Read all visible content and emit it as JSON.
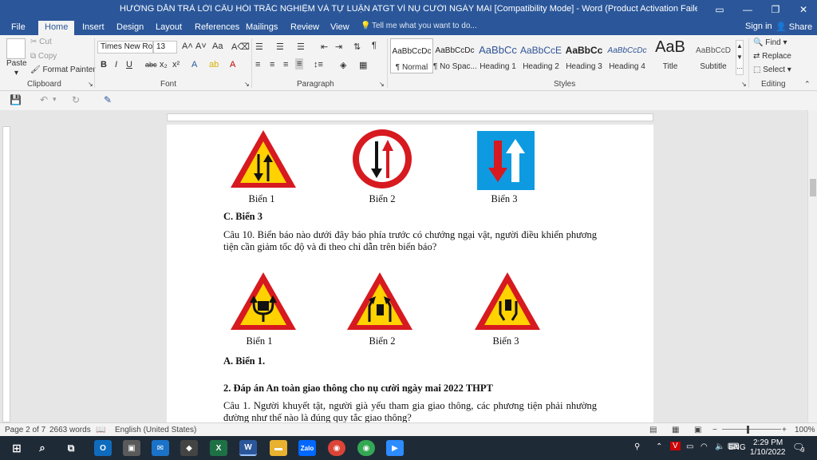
{
  "window": {
    "title": "HƯỚNG DẪN TRẢ LỜI CÂU HỎI TRẮC NGHIỆM VÀ TỰ LUẬN ATGT VÌ NỤ CƯỜI NGÀY MAI [Compatibility Mode] - Word (Product Activation Failed)"
  },
  "tabs": [
    "File",
    "Home",
    "Insert",
    "Design",
    "Layout",
    "References",
    "Mailings",
    "Review",
    "View"
  ],
  "tell_me": "Tell me what you want to do...",
  "sign_in": "Sign in",
  "share": "Share",
  "clipboard": {
    "paste": "Paste",
    "cut": "Cut",
    "copy": "Copy",
    "format_painter": "Format Painter",
    "label": "Clipboard"
  },
  "font": {
    "name": "Times New Ro",
    "size": "13",
    "label": "Font"
  },
  "paragraph": {
    "label": "Paragraph"
  },
  "styles": {
    "label": "Styles",
    "items": [
      {
        "preview": "AaBbCcDc",
        "name": "¶ Normal"
      },
      {
        "preview": "AaBbCcDc",
        "name": "¶ No Spac..."
      },
      {
        "preview": "AaBbCc",
        "name": "Heading 1"
      },
      {
        "preview": "AaBbCcE",
        "name": "Heading 2"
      },
      {
        "preview": "AaBbCc",
        "name": "Heading 3"
      },
      {
        "preview": "AaBbCcDc",
        "name": "Heading 4"
      },
      {
        "preview": "AaB",
        "name": "Title"
      },
      {
        "preview": "AaBbCcD",
        "name": "Subtitle"
      }
    ]
  },
  "editing": {
    "find": "Find",
    "replace": "Replace",
    "select": "Select",
    "label": "Editing"
  },
  "document": {
    "row1_captions": [
      "Biển 1",
      "Biển 2",
      "Biển 3"
    ],
    "answer_c": "C. Biển 3",
    "question10": "Câu 10. Biển báo nào dưới đây báo phía trước có chướng ngại vật, người điều khiển phương tiện cần giảm tốc độ và đi theo chỉ dẫn trên biển báo?",
    "row2_captions": [
      "Biển 1",
      "Biển 2",
      "Biển 3"
    ],
    "answer_a": "A. Biển 1.",
    "heading2": "2. Đáp án An toàn giao thông cho nụ cười ngày mai 2022 THPT",
    "question1": "Câu 1. Người khuyết tật, người già yếu tham gia giao thông, các phương tiện phải nhường đường như thế nào là đúng quy tắc giao thông?"
  },
  "status": {
    "page": "Page 2 of 7",
    "words": "2663 words",
    "language": "English (United States)",
    "zoom": "100%"
  },
  "taskbar": {
    "lang": "ENG",
    "time": "2:29 PM",
    "date": "1/10/2022",
    "notif_count": "9"
  },
  "colors": {
    "word_blue": "#2b579a",
    "sign_red": "#d71920",
    "sign_yellow": "#ffd200",
    "sign_blue": "#0e9ae0"
  }
}
